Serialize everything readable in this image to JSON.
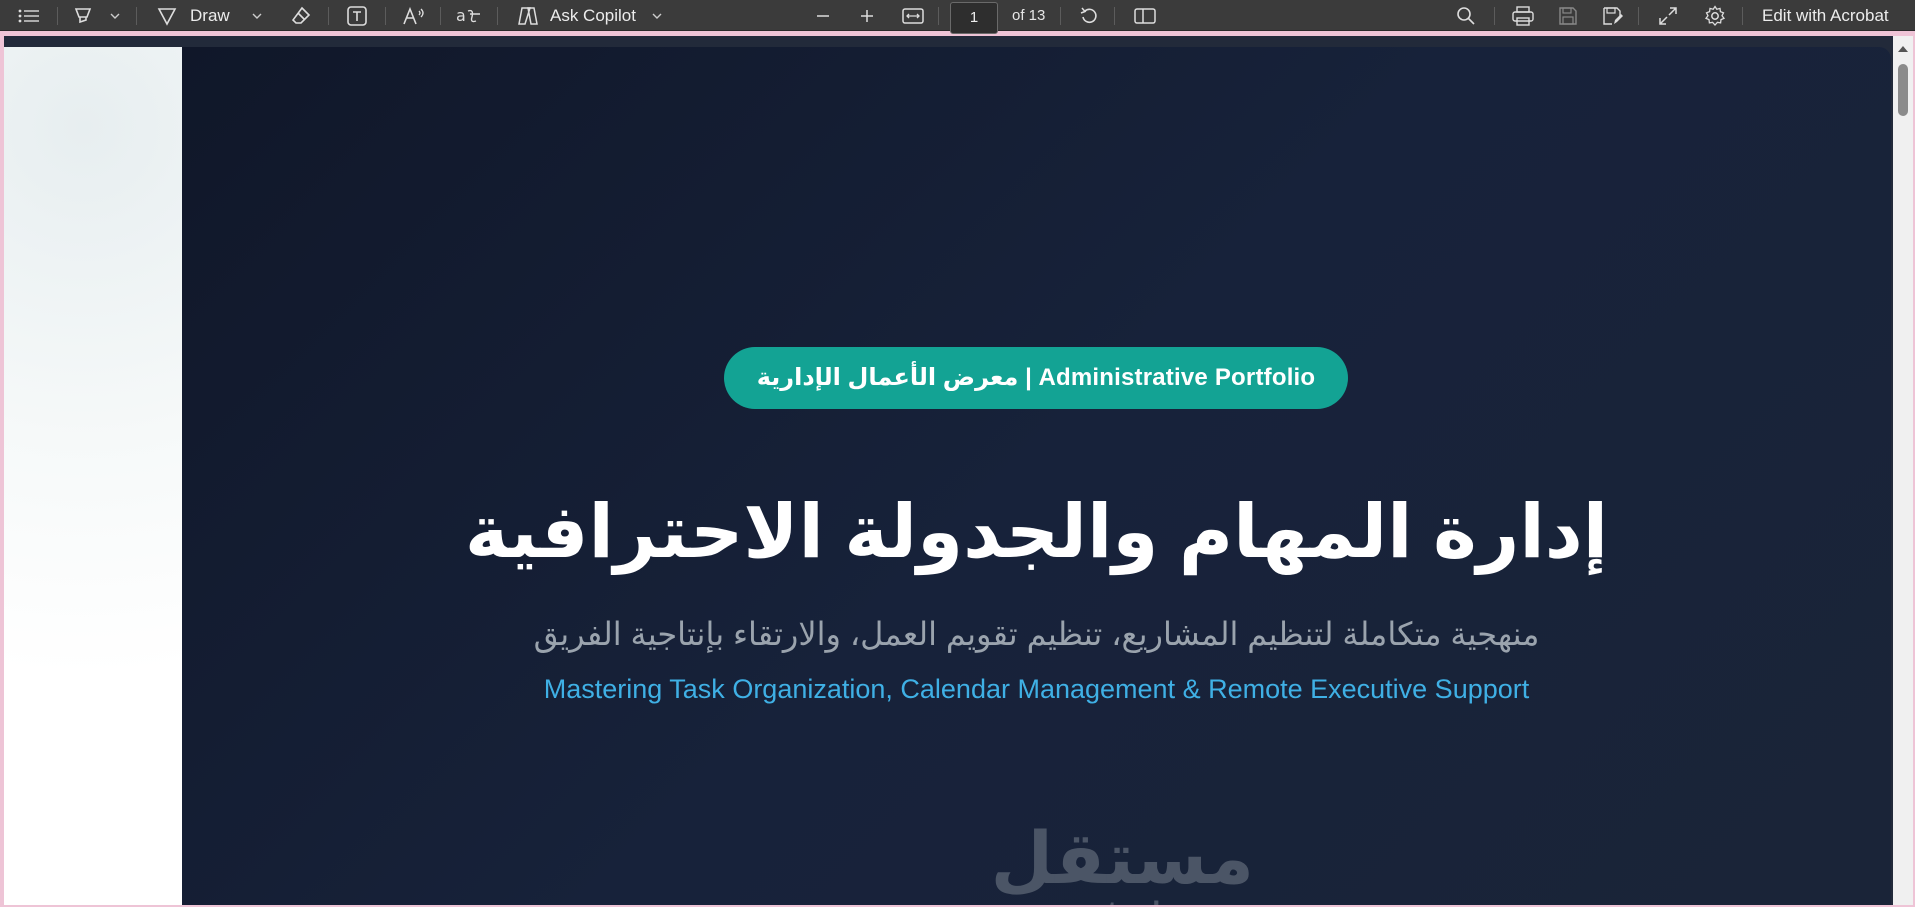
{
  "toolbar": {
    "draw_label": "Draw",
    "ask_copilot_label": "Ask Copilot",
    "current_page": "1",
    "page_total": "of 13",
    "edit_acrobat_label": "Edit with Acrobat"
  },
  "icons": {
    "contents": "list-icon",
    "highlight": "highlighter-icon",
    "draw": "pen-icon",
    "erase": "eraser-icon",
    "text": "text-box-icon",
    "read_aloud": "read-aloud-icon",
    "translate": "translate-icon",
    "copilot": "copilot-icon",
    "zoom_out": "minus-icon",
    "zoom_in": "plus-icon",
    "fit": "fit-width-icon",
    "rotate": "rotate-icon",
    "page_view": "page-view-icon",
    "search": "search-icon",
    "print": "print-icon",
    "save": "save-icon",
    "save_as": "save-as-icon",
    "fullscreen": "fullscreen-icon",
    "settings": "gear-icon"
  },
  "slide": {
    "badge": "معرض الأعمال الإدارية | Administrative Portfolio",
    "title": "إدارة المهام والجدولة الاحترافية",
    "subtitle_ar": "منهجية متكاملة لتنظيم المشاريع، تنظيم تقويم العمل، والارتقاء بإنتاجية الفريق",
    "subtitle_en": "Mastering Task Organization, Calendar Management & Remote Executive Support",
    "watermark_ar": "مستقل",
    "watermark_en": "mostaql.com"
  },
  "colors": {
    "toolbar_bg": "#3b3b3b",
    "slide_bg": "#131b2e",
    "badge_bg": "#13a394",
    "accent_blue": "#3fb0e5"
  }
}
